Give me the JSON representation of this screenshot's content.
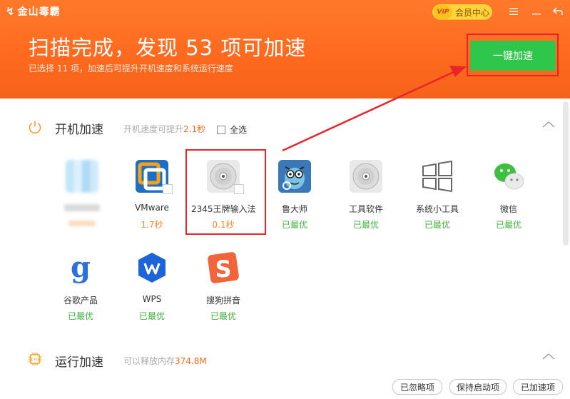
{
  "app": {
    "name": "金山毒霸",
    "vip_label": "会员中心",
    "vip_badge": "VIP"
  },
  "scan": {
    "title": "扫描完成，发现 53 项可加速",
    "subtitle": "已选择 11 项，加速后可提升开机速度和系统运行速度",
    "accelerate_button": "一键加速"
  },
  "boot": {
    "title": "开机加速",
    "hint_prefix": "开机速度可提升",
    "hint_value": "2.1秒",
    "select_all": "全选",
    "items": [
      {
        "name": "",
        "status": ""
      },
      {
        "name": "VMware",
        "status": "1.7秒"
      },
      {
        "name": "2345王牌输入法",
        "status": "0.1秒"
      },
      {
        "name": "鲁大师",
        "status": "已最优"
      },
      {
        "name": "工具软件",
        "status": "已最优"
      },
      {
        "name": "系统小工具",
        "status": "已最优"
      },
      {
        "name": "微信",
        "status": "已最优"
      },
      {
        "name": "谷歌产品",
        "status": "已最优"
      },
      {
        "name": "WPS",
        "status": "已最优"
      },
      {
        "name": "搜狗拼音",
        "status": "已最优"
      }
    ]
  },
  "runtime": {
    "title": "运行加速",
    "hint_prefix": "可以释放内存",
    "hint_value": "374.8M"
  },
  "footer": {
    "ignored": "已忽略项",
    "keep_startup": "保持启动项",
    "accelerated": "已加速项"
  },
  "colors": {
    "header_orange": "#ff6a1f",
    "accelerate_green": "#2fc64c",
    "status_green": "#3fb33f",
    "status_orange": "#ff8c2a",
    "annotation_red": "#e8252b"
  }
}
